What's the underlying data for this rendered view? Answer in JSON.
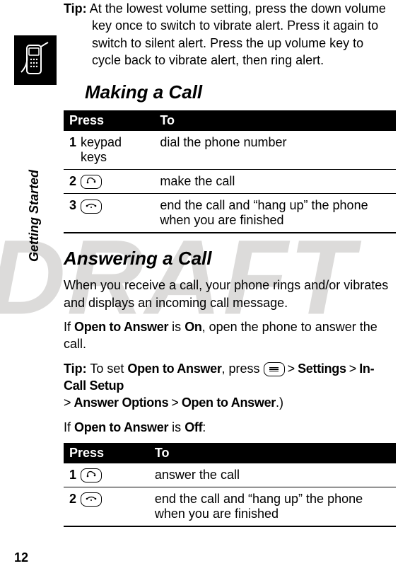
{
  "watermark": "DRAFT",
  "side": {
    "label": "Getting Started"
  },
  "tip": {
    "label": "Tip:",
    "text_line1": "At the lowest volume setting, press the down",
    "text_rest": "volume key once to switch to vibrate alert. Press it again to switch to silent alert. Press the up volume key to cycle back to vibrate alert, then ring alert."
  },
  "sections": {
    "making": {
      "title": "Making a Call"
    },
    "answering": {
      "title": "Answering a Call"
    }
  },
  "table_headers": {
    "press": "Press",
    "to": "To"
  },
  "making_rows": [
    {
      "num": "1",
      "press": "keypad keys",
      "press_type": "text",
      "to": "dial the phone number"
    },
    {
      "num": "2",
      "press": "send",
      "press_type": "icon",
      "icon_glyph": "📞",
      "to": "make the call"
    },
    {
      "num": "3",
      "press": "end",
      "press_type": "icon",
      "icon_glyph": "☎",
      "to": "end the call and “hang up” the phone when you are finished"
    }
  ],
  "answering_intro": "When you receive a call, your phone rings and/or vibrates and displays an incoming call message.",
  "answering_para1": {
    "pre": "If ",
    "cond1": "Open to Answer",
    "mid": " is ",
    "cond2": "On",
    "post": ", open the phone to answer the call."
  },
  "answering_tip": {
    "label": "Tip:",
    "pre": " To set ",
    "p1": "Open to Answer",
    "between1": ", press ",
    "menu_key": "menu",
    "gt": ">",
    "p2": "Settings",
    "p3": "In-Call Setup",
    "p4": "Answer Options",
    "p5": "Open to Answer",
    "post": ".)"
  },
  "answering_para2": {
    "pre": "If ",
    "cond1": "Open to Answer",
    "mid": " is ",
    "cond2": "Off",
    "post": ":"
  },
  "answering_rows": [
    {
      "num": "1",
      "press": "send",
      "press_type": "icon",
      "icon_glyph": "📞",
      "to": "answer the call"
    },
    {
      "num": "2",
      "press": "end",
      "press_type": "icon",
      "icon_glyph": "☎",
      "to": "end the call and “hang up” the phone when you are finished"
    }
  ],
  "pagenum": "12"
}
